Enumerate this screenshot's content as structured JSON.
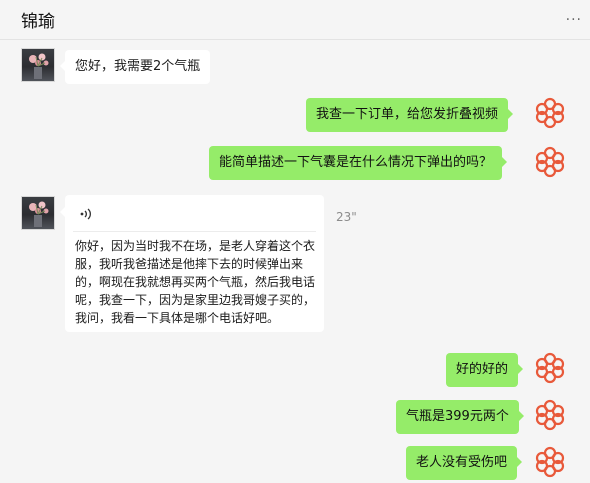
{
  "chat": {
    "contact_name": "锦瑜",
    "more_label": "···"
  },
  "messages": [
    {
      "side": "in",
      "text": "您好，我需要2个气瓶"
    },
    {
      "side": "out",
      "text": "我查一下订单，给您发折叠视频"
    },
    {
      "side": "out",
      "text": "能简单描述一下气囊是在什么情况下弹出的吗？"
    },
    {
      "side": "in",
      "type": "voice",
      "duration": "23\"",
      "transcript": "你好，因为当时我不在场，是老人穿着这个衣服，我听我爸描述是他摔下去的时候弹出来的，啊现在我就想再买两个气瓶，然后我电话呢，我查一下，因为是家里边我哥嫂子买的，我问，我看一下具体是哪个电话好吧。"
    },
    {
      "side": "out",
      "text": "好的好的"
    },
    {
      "side": "out",
      "text": "气瓶是399元两个"
    },
    {
      "side": "out",
      "text": "老人没有受伤吧"
    }
  ],
  "colors": {
    "background": "#f5f5f5",
    "bubble_out": "#95ec69",
    "bubble_in": "#ffffff",
    "brand_logo": "#e8593a"
  },
  "icons": {
    "self_avatar": "flower-logo-icon",
    "voice": "voice-wave-icon",
    "more": "more-dots-icon"
  }
}
